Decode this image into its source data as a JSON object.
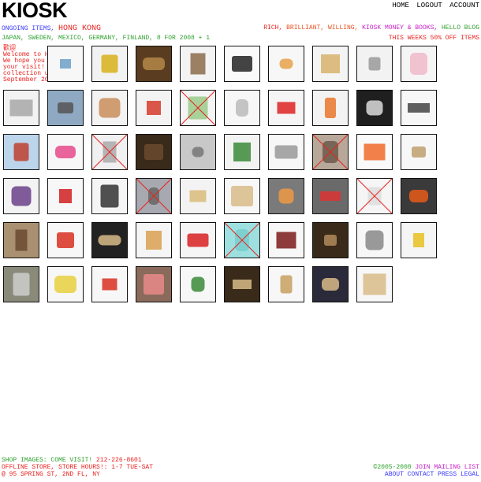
{
  "header": {
    "logo": "KIOSK",
    "nav": [
      "HOME",
      "LOGOUT",
      "ACCOUNT"
    ]
  },
  "subheader": {
    "ongoing_label": "ONGOING ITEMS,",
    "location": "HONG KONG",
    "right_links": [
      "RICH,",
      "BRILLIANT,",
      "WILLING,",
      "KIOSK MONEY & BOOKS,",
      "HELLO BLOG"
    ],
    "countries": "JAPAN, SWEDEN, MEXICO, GERMANY, FINLAND, 8 FOR 2008 + 1",
    "sale": "THIS WEEKS 50% OFF ITEMS"
  },
  "welcome": {
    "zh": "歡迎",
    "text": "Welcome to Hong Kong! We hope you enjoy your visit! Featured collection until September 2008."
  },
  "items": [
    {
      "icon": "paper-bags-icon",
      "sold": false,
      "bg": "#f7f7f7",
      "fg": "#6da0c8"
    },
    {
      "icon": "tin-box-icon",
      "sold": false,
      "bg": "#f2f2f2",
      "fg": "#d8b01a"
    },
    {
      "icon": "wicker-basket-icon",
      "sold": false,
      "bg": "#5a3d20",
      "fg": "#b4874a"
    },
    {
      "icon": "incense-box-icon",
      "sold": false,
      "bg": "#f3f3f3",
      "fg": "#8c6b4a"
    },
    {
      "icon": "steel-kettle-icon",
      "sold": false,
      "bg": "#fafafa",
      "fg": "#222222"
    },
    {
      "icon": "comb-icon",
      "sold": false,
      "bg": "#f7f7f7",
      "fg": "#e6a24a"
    },
    {
      "icon": "bamboo-steamer-icon",
      "sold": false,
      "bg": "#f4f4f4",
      "fg": "#d7b26b"
    },
    {
      "icon": "tin-can-icon",
      "sold": false,
      "bg": "#f2f2f2",
      "fg": "#9a9a9a"
    },
    {
      "icon": "notebook-icon",
      "sold": false,
      "bg": "#f5f5f5",
      "fg": "#f0b8c8"
    },
    {
      "icon": "strainer-icon",
      "sold": false,
      "bg": "#f2f2f2",
      "fg": "#a8a8a8"
    },
    {
      "icon": "street-photo-icon",
      "sold": false,
      "bg": "#8fa9c2",
      "fg": "#555"
    },
    {
      "icon": "paper-stack-icon",
      "sold": false,
      "bg": "#f3f3f3",
      "fg": "#c98c5a"
    },
    {
      "icon": "card-pack-icon",
      "sold": false,
      "bg": "#f3f3f3",
      "fg": "#d43a2a"
    },
    {
      "icon": "green-fan-icon",
      "sold": true,
      "bg": "#f4f4f4",
      "fg": "#9acb8a"
    },
    {
      "icon": "hook-icon",
      "sold": false,
      "bg": "#f7f7f7",
      "fg": "#bbbbbb"
    },
    {
      "icon": "red-gold-box-icon",
      "sold": false,
      "bg": "#f5f5f5",
      "fg": "#d22"
    },
    {
      "icon": "orange-box-icon",
      "sold": false,
      "bg": "#f3f3f3",
      "fg": "#e8762a"
    },
    {
      "icon": "paper-package-icon",
      "sold": false,
      "bg": "#1f1f1f",
      "fg": "#ddd"
    },
    {
      "icon": "cleaver-icon",
      "sold": false,
      "bg": "#f7f7f7",
      "fg": "#444"
    },
    {
      "icon": "kite-icon",
      "sold": false,
      "bg": "#bcd5ea",
      "fg": "#c04030"
    },
    {
      "icon": "chopsticks-icon",
      "sold": false,
      "bg": "#f7f7f7",
      "fg": "#e64a8a"
    },
    {
      "icon": "sold-item-icon",
      "sold": true,
      "bg": "#f0f0f0",
      "fg": "#aaa"
    },
    {
      "icon": "brown-bag-icon",
      "sold": false,
      "bg": "#3a2a1a",
      "fg": "#6b4a30"
    },
    {
      "icon": "hanging-photo-icon",
      "sold": false,
      "bg": "#c8c8c8",
      "fg": "#777"
    },
    {
      "icon": "alphabet-blocks-icon",
      "sold": false,
      "bg": "#f3f3f3",
      "fg": "#3a8a3a"
    },
    {
      "icon": "pot-icon",
      "sold": false,
      "bg": "#f7f7f7",
      "fg": "#999"
    },
    {
      "icon": "bench-photo-icon",
      "sold": true,
      "bg": "#b8a89a",
      "fg": "#6b5a4a"
    },
    {
      "icon": "orange-spoon-icon",
      "sold": false,
      "bg": "#fafafa",
      "fg": "#ee6a2a"
    },
    {
      "icon": "brush-icon",
      "sold": false,
      "bg": "#f7f7f7",
      "fg": "#c0a070"
    },
    {
      "icon": "slipper-icon",
      "sold": false,
      "bg": "#f3f3f3",
      "fg": "#6a3f8a"
    },
    {
      "icon": "ping-pong-icon",
      "sold": false,
      "bg": "#f7f7f7",
      "fg": "#d02020"
    },
    {
      "icon": "sandals-icon",
      "sold": false,
      "bg": "#f5f5f5",
      "fg": "#333"
    },
    {
      "icon": "sold-tray-icon",
      "sold": true,
      "bg": "#a8a8b0",
      "fg": "#666"
    },
    {
      "icon": "cardboard-icon",
      "sold": false,
      "bg": "#f3f3f3",
      "fg": "#d8bb7a"
    },
    {
      "icon": "paddle-icon",
      "sold": false,
      "bg": "#f7f7f7",
      "fg": "#d8bb88"
    },
    {
      "icon": "candy-bag-icon",
      "sold": false,
      "bg": "#7a7a7a",
      "fg": "#e94"
    },
    {
      "icon": "candy-pack-icon",
      "sold": false,
      "bg": "#6a6a6a",
      "fg": "#d33"
    },
    {
      "icon": "sold-shirt-icon",
      "sold": true,
      "bg": "#f5f5f5",
      "fg": "#ddd"
    },
    {
      "icon": "orange-lamp-icon",
      "sold": false,
      "bg": "#3a3a3a",
      "fg": "#e85a1a"
    },
    {
      "icon": "market-photo-icon",
      "sold": false,
      "bg": "#a89070",
      "fg": "#6b4a30"
    },
    {
      "icon": "red-stick-icon",
      "sold": false,
      "bg": "#f7f7f7",
      "fg": "#d83020"
    },
    {
      "icon": "pastry-bag-icon",
      "sold": false,
      "bg": "#222",
      "fg": "#d8bb88"
    },
    {
      "icon": "bread-basket-icon",
      "sold": false,
      "bg": "#f5f5f5",
      "fg": "#d8a050"
    },
    {
      "icon": "snack-box-icon",
      "sold": false,
      "bg": "#f5f5f5",
      "fg": "#d82020"
    },
    {
      "icon": "sold-cyan-icon",
      "sold": true,
      "bg": "#9ee0e0",
      "fg": "#7cc"
    },
    {
      "icon": "sauce-bottle-icon",
      "sold": false,
      "bg": "#f7f7f7",
      "fg": "#7a1a1a"
    },
    {
      "icon": "sieve-photo-icon",
      "sold": false,
      "bg": "#3a2a1a",
      "fg": "#b08a5a"
    },
    {
      "icon": "tea-strainer-icon",
      "sold": false,
      "bg": "#f7f7f7",
      "fg": "#888"
    },
    {
      "icon": "calculator-icon",
      "sold": false,
      "bg": "#f5f5f5",
      "fg": "#e8c020"
    },
    {
      "icon": "knife-photo-icon",
      "sold": false,
      "bg": "#8a8a7a",
      "fg": "#ccc"
    },
    {
      "icon": "greeting-card-icon",
      "sold": false,
      "bg": "#f7f7f7",
      "fg": "#e8d040"
    },
    {
      "icon": "striped-ball-icon",
      "sold": false,
      "bg": "#f7f7f7",
      "fg": "#d83020"
    },
    {
      "icon": "pink-case-icon",
      "sold": false,
      "bg": "#8a6a5a",
      "fg": "#e88a8a"
    },
    {
      "icon": "toiletries-icon",
      "sold": false,
      "bg": "#f7f7f7",
      "fg": "#3a8a3a"
    },
    {
      "icon": "fan-photo-icon",
      "sold": false,
      "bg": "#3a2a1a",
      "fg": "#d8bb88"
    },
    {
      "icon": "whisk-broom-icon",
      "sold": false,
      "bg": "#f7f7f7",
      "fg": "#c8a060"
    },
    {
      "icon": "bamboo-mat-photo-icon",
      "sold": false,
      "bg": "#2a2a3a",
      "fg": "#d8bb88"
    },
    {
      "icon": "bamboo-mat-icon",
      "sold": false,
      "bg": "#f7f7f7",
      "fg": "#d8bb88"
    }
  ],
  "footer": {
    "shop_label": "SHOP IMAGES: COME VISIT!",
    "phone": "212-226-8601",
    "store_hours": "OFFLINE STORE, STORE HOURS!: 1-7 TUE-SAT",
    "address": "@ 95 SPRING ST, 2ND FL, NY",
    "copyright": "©2005-2008",
    "mailing": "JOIN MAILING LIST",
    "links": [
      "ABOUT",
      "CONTACT",
      "PRESS",
      "LEGAL"
    ]
  }
}
